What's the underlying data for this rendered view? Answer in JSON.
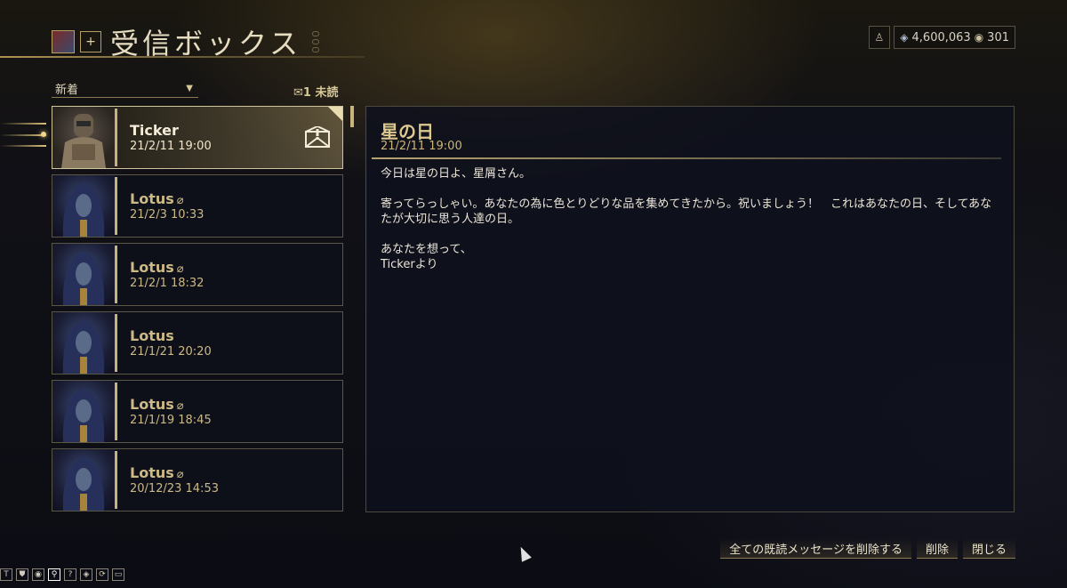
{
  "header": {
    "title": "受信ボックス",
    "add_label": "+"
  },
  "currency": {
    "credits": "4,600,063",
    "platinum": "301",
    "credits_icon": "credits-icon",
    "platinum_icon": "platinum-icon"
  },
  "filter": {
    "selected": "新着"
  },
  "unread_label": "1 未読",
  "messages": [
    {
      "sender": "Ticker",
      "date": "21/2/11 19:00",
      "attachment": false,
      "unread": true,
      "selected": true
    },
    {
      "sender": "Lotus",
      "date": "21/2/3 10:33",
      "attachment": true
    },
    {
      "sender": "Lotus",
      "date": "21/2/1 18:32",
      "attachment": true
    },
    {
      "sender": "Lotus",
      "date": "21/1/21 20:20",
      "attachment": false
    },
    {
      "sender": "Lotus",
      "date": "21/1/19 18:45",
      "attachment": true
    },
    {
      "sender": "Lotus",
      "date": "20/12/23 14:53",
      "attachment": true
    }
  ],
  "reader": {
    "title": "星の日",
    "date": "21/2/11 19:00",
    "body": [
      "今日は星の日よ、星屑さん。",
      "寄ってらっしゃい。あなたの為に色とりどりな品を集めてきたから。祝いましょう！　これはあなたの日、そしてあなたが大切に思う人達の日。",
      "あなたを想って、\nTickerより"
    ]
  },
  "actions": {
    "delete_read": "全ての既読メッセージを削除する",
    "delete": "削除",
    "close": "閉じる"
  },
  "taskbar": [
    "T",
    "⛊",
    "◉",
    "⚲",
    "?",
    "◈",
    "⟳",
    "▭"
  ],
  "colors": {
    "accent": "#c6b27a",
    "text": "#ece6d8"
  }
}
